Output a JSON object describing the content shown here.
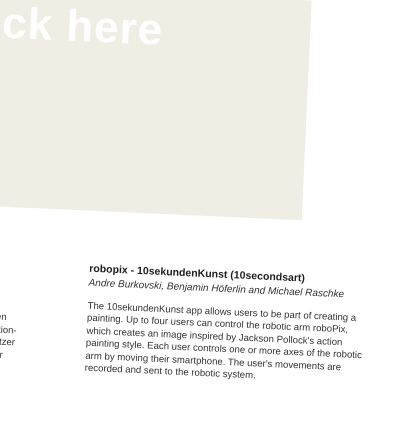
{
  "hero": {
    "text": "click here"
  },
  "left_column": {
    "italic_fragment": "ke",
    "lines": [
      "tstehen",
      "nnen den",
      "dem Action-",
      "er Benutzer",
      "hne oder"
    ]
  },
  "article": {
    "title": "robopix - 10sekundenKunst (10secondsart)",
    "authors": "Andre Burkovski, Benjamin Höferlin and Michael Raschke",
    "body_lines": [
      "The 10sekundenKunst app allows users to be part of creating a",
      "painting. Up to four users can control the robotic arm roboPix,",
      "which creates an image inspired by Jackson Pollock's action",
      "painting style. Each user controls one or more axes of the robotic",
      "arm by moving their smartphone. The user's movements are",
      "recorded and sent to the robotic system."
    ]
  }
}
